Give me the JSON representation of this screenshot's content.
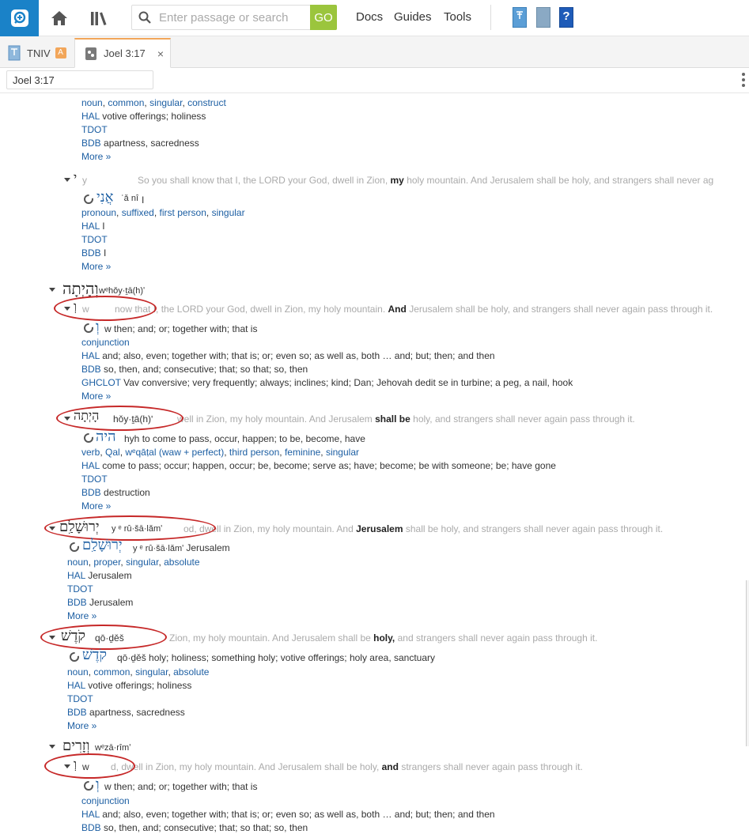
{
  "toolbar": {
    "search_placeholder": "Enter passage or search",
    "go_label": "GO",
    "nav": [
      "Docs",
      "Guides",
      "Tools"
    ]
  },
  "tabs": [
    {
      "label": "TNIV",
      "badge": "A"
    },
    {
      "label": "Joel 3:17",
      "close": "×"
    }
  ],
  "reference": {
    "value": "Joel 3:17"
  },
  "colors": {
    "logo": "#1a82c8",
    "go": "#9bc53d",
    "tab_accent": "#f2a65a",
    "link": "#1d5fa3",
    "annotation_ring": "#c62828"
  },
  "more_label": "More »",
  "entries": {
    "e1": {
      "morph": [
        "noun",
        "common",
        "singular",
        "construct"
      ],
      "hal_label": "HAL",
      "hal_text": "votive offerings; holiness",
      "tdot": "TDOT",
      "bdb_label": "BDB",
      "bdb_text": "apartness, sacredness"
    },
    "e2": {
      "surface": "י",
      "translit": "y",
      "context_pre": "So you shall know that I, the LORD your God, dwell in Zion,",
      "context_hit": "my",
      "context_post": "holy mountain. And Jerusalem shall be holy, and strangers shall never ag",
      "lemma": "אֲנִי",
      "lemma_translit": "ʾǎ nî",
      "gloss": "I",
      "morph": [
        "pronoun",
        "suffixed",
        "first person",
        "singular"
      ],
      "hal_label": "HAL",
      "hal_text": "I",
      "tdot": "TDOT",
      "bdb_label": "BDB",
      "bdb_text": "I"
    },
    "w3": {
      "surface": "וְהָיְתָה",
      "translit": "wᵉhǒy·ṯā(h)ʹ"
    },
    "e3": {
      "surface": "וְ",
      "translit": "w",
      "context_pre": "now that I, the LORD your God, dwell in Zion, my holy mountain.",
      "context_hit": "And",
      "context_post": "Jerusalem shall be holy, and strangers shall never again pass through it.",
      "lemma": "וְ",
      "lemma_translit": "w",
      "gloss": "then; and; or; together with; that is",
      "morph": [
        "conjunction"
      ],
      "hal_label": "HAL",
      "hal_text": "and; also, even; together with; that is; or; even so; as well as, both … and; but; then; and then",
      "bdb_label": "BDB",
      "bdb_text": "so, then, and; consecutive; that; so that; so, then",
      "ghclot_label": "GHCLOT",
      "ghclot_text": "Vav conversive; very frequently; always; inclines; kind; Dan; Jehovah dedit se in turbine; a peg, a nail, hook"
    },
    "e4": {
      "surface": "הָיְתָה",
      "translit": "hǒy·ṯā(h)ʹ",
      "context_pre": "well in Zion, my holy mountain. And Jerusalem",
      "context_hit": "shall be",
      "context_post": "holy, and strangers shall never again pass through it.",
      "lemma": "היה",
      "lemma_translit": "hyh",
      "gloss": "to come to pass, occur, happen; to be, become, have",
      "morph": [
        "verb",
        "Qal",
        "wᵉqāṭal (waw + perfect)",
        "third person",
        "feminine",
        "singular"
      ],
      "hal_label": "HAL",
      "hal_text": "come to pass; occur; happen, occur; be, become; serve as; have; become; be with someone; be; have gone",
      "tdot": "TDOT",
      "bdb_label": "BDB",
      "bdb_text": "destruction"
    },
    "e5": {
      "surface": "יְרוּשָׁלִַם",
      "translit": "y ᵉ rû·šā·lǎmʹ",
      "context_pre": "od, dwell in Zion, my holy mountain. And",
      "context_hit": "Jerusalem",
      "context_post": "shall be holy, and strangers shall never again pass through it.",
      "lemma": "יְרוּשָׁלִַם",
      "lemma_translit": "y ᵉ rû·šā·lǎmʹ",
      "gloss": "Jerusalem",
      "morph": [
        "noun",
        "proper",
        "singular",
        "absolute"
      ],
      "hal_label": "HAL",
      "hal_text": "Jerusalem",
      "tdot": "TDOT",
      "bdb_label": "BDB",
      "bdb_text": "Jerusalem"
    },
    "e6": {
      "surface": "קֹדֶשׁ",
      "translit": "qō·ḏěš",
      "context_pre": "Zion, my holy mountain. And Jerusalem shall be",
      "context_hit": "holy,",
      "context_post": "and strangers shall never again pass through it.",
      "lemma": "קֹדֶשׁ",
      "lemma_translit": "qō·ḏěš",
      "gloss": "holy; holiness; something holy; votive offerings; holy area, sanctuary",
      "morph": [
        "noun",
        "common",
        "singular",
        "absolute"
      ],
      "hal_label": "HAL",
      "hal_text": "votive offerings; holiness",
      "tdot": "TDOT",
      "bdb_label": "BDB",
      "bdb_text": "apartness, sacredness"
    },
    "w7": {
      "surface": "וְזָרִים",
      "translit": "wᵉzā·rîmʹ"
    },
    "e7": {
      "surface": "וְ",
      "translit": "w",
      "context_pre": "d, dwell in Zion, my holy mountain. And Jerusalem shall be holy,",
      "context_hit": "and",
      "context_post": "strangers shall never again pass through it.",
      "lemma": "וְ",
      "lemma_translit": "w",
      "gloss": "then; and; or; together with; that is",
      "morph": [
        "conjunction"
      ],
      "hal_label": "HAL",
      "hal_text": "and; also, even; together with; that is; or; even so; as well as, both … and; but; then; and then",
      "bdb_label": "BDB",
      "bdb_text": "so, then, and; consecutive; that; so that; so, then"
    }
  }
}
